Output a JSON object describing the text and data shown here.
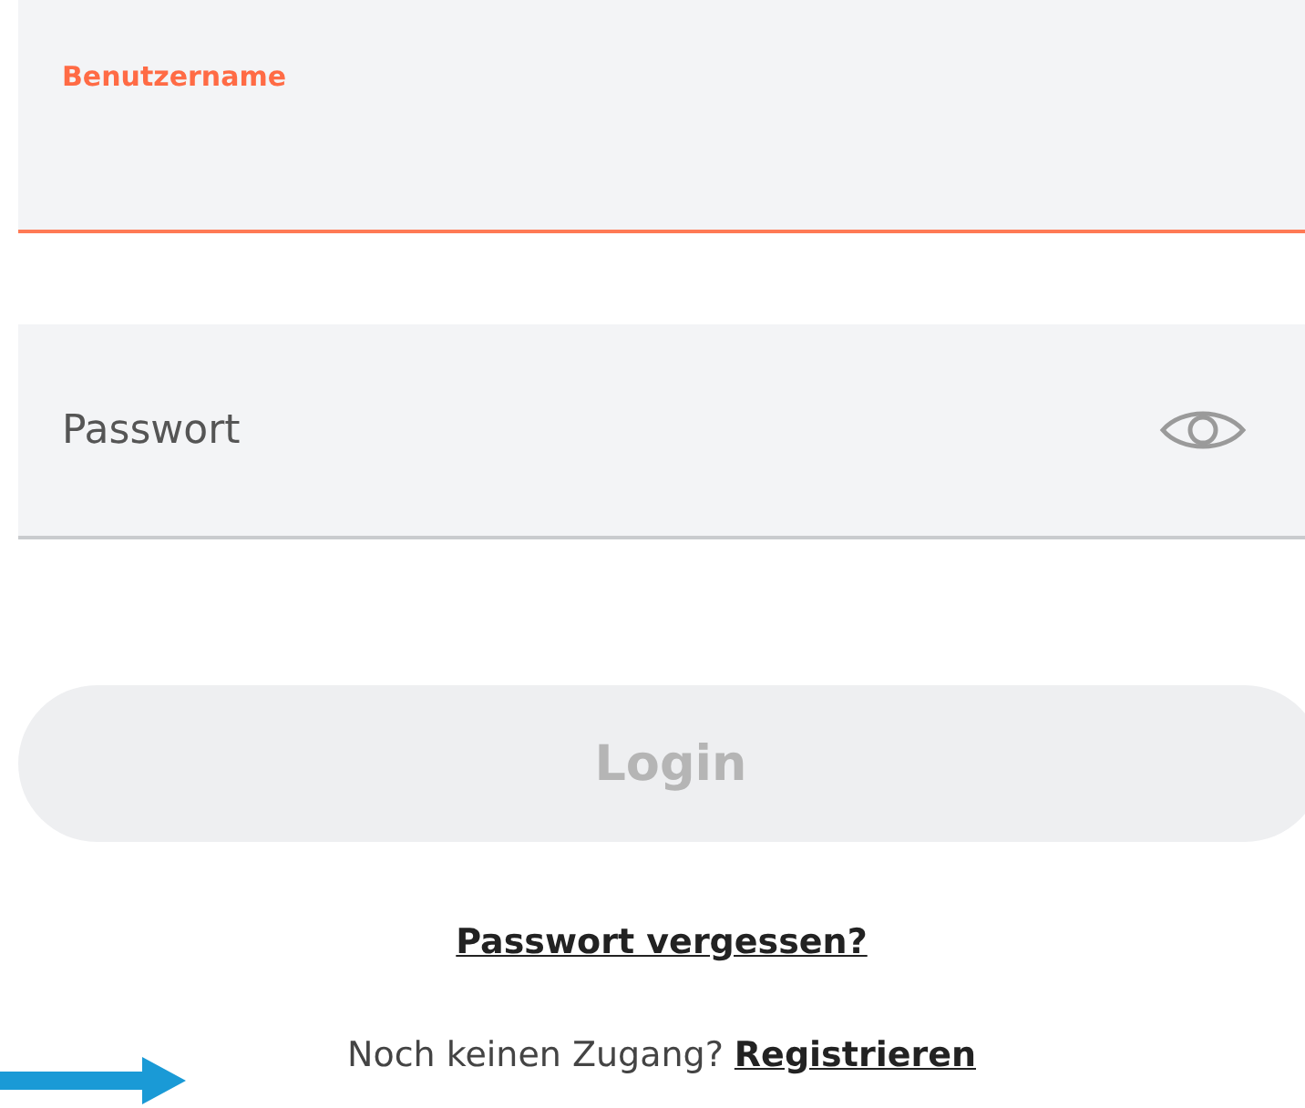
{
  "username_field": {
    "label": "Benutzername",
    "focused": true
  },
  "password_field": {
    "placeholder": "Passwort",
    "focused": false
  },
  "login_button": {
    "label": "Login",
    "disabled": true
  },
  "forgot_password_link": "Passwort vergessen?",
  "register_prompt": {
    "text": "Noch keinen Zugang?",
    "link": "Registrieren"
  }
}
